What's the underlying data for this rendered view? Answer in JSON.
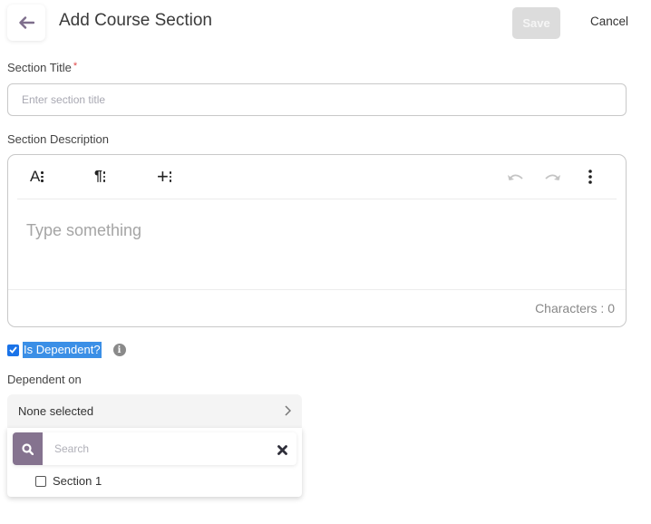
{
  "header": {
    "title": "Add Course Section",
    "save_label": "Save",
    "cancel_label": "Cancel"
  },
  "form": {
    "section_title": {
      "label": "Section Title",
      "required_mark": "*",
      "value": "",
      "placeholder": "Enter section title"
    },
    "section_description": {
      "label": "Section Description",
      "toolbar": {
        "text_style_glyph": "A",
        "paragraph_glyph": "¶",
        "insert_glyph": "+"
      },
      "placeholder": "Type something",
      "char_count_label": "Characters : 0"
    },
    "is_dependent": {
      "label": "Is Dependent?",
      "checked": true
    },
    "dependent_on": {
      "label": "Dependent on",
      "selected_text": "None selected",
      "search_placeholder": "Search",
      "options": [
        {
          "label": "Section 1",
          "checked": false
        }
      ]
    }
  },
  "colors": {
    "accent": "#85738f",
    "checkbox_blue": "#1a73e8",
    "selection_highlight": "#3b8fe6",
    "save_disabled": "#dcdcdc",
    "required": "#e04848"
  }
}
